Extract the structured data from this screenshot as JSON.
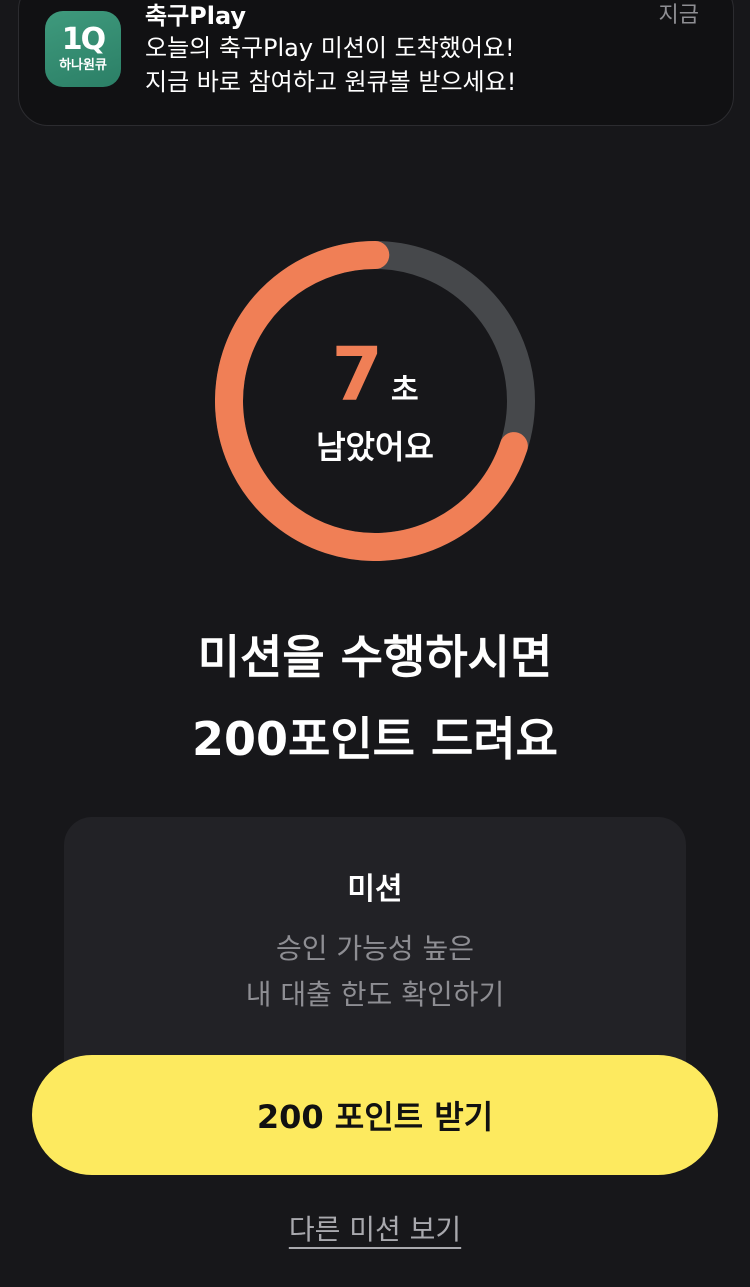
{
  "notification": {
    "app_icon": "hana-one-q-logo",
    "logo_mark": "1Q",
    "logo_text": "하나원큐",
    "title": "축구Play",
    "time": "지금",
    "line1": "오늘의 축구Play 미션이 도착했어요!",
    "line2": "지금 바로 참여하고 원큐볼 받으세요!"
  },
  "timer": {
    "value": "7",
    "unit": "초",
    "caption": "남았어요",
    "remaining_fraction": 0.7,
    "progress_color": "#f07f56",
    "track_color": "#46484b"
  },
  "headline": {
    "line1": "미션을 수행하시면",
    "line2": "200포인트 드려요"
  },
  "mission": {
    "title": "미션",
    "line1": "승인 가능성 높은",
    "line2": "내 대출 한도 확인하기"
  },
  "cta": {
    "label": "200 포인트 받기",
    "color": "#fdea5f"
  },
  "other_link": {
    "label": "다른 미션 보기"
  }
}
